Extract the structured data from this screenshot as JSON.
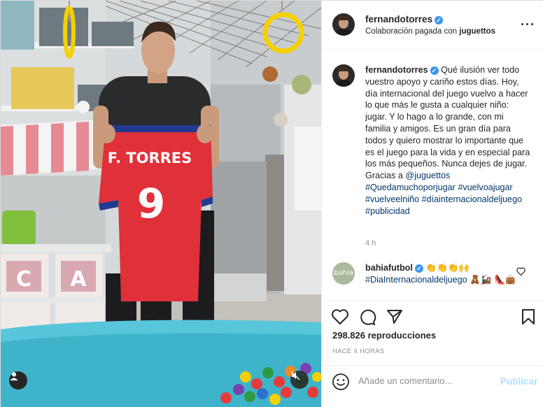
{
  "post": {
    "username": "fernandotorres",
    "verified_mark": "✓",
    "paid_prefix": "Colaboración pagada con",
    "paid_partner": "juguettos",
    "more_icon": "more-dots-icon"
  },
  "media": {
    "jersey_name": "F. TORRES",
    "jersey_number": "9",
    "box_letters": [
      "C",
      "A"
    ],
    "colors": {
      "jersey": "#e0303a",
      "ring": "#f5d000",
      "pool": "#3fb3c9"
    }
  },
  "caption": {
    "username": "fernandotorres",
    "text_main": "Qué ilusión ver todo vuestro apoyo y cariño estos días. Hoy, día internacional del juego vuelvo a hacer lo que más le gusta a cualquier niño: jugar. Y lo hago a lo grande, con mi familia y amigos. Es un gran día para todos y quiero mostrar lo importante que es el juego para la vida y en especial para los más pequeños. Nunca dejes de jugar. Gracias a",
    "mention": "@juguettos",
    "hashtags": [
      "#Quedamuchoporjugar",
      "#vuelvoajugar",
      "#vuelveelniño",
      "#díainternacionaldeljuego",
      "#publicidad"
    ],
    "time": "4 h"
  },
  "comment": {
    "username": "bahiafutbol",
    "avatar_text": "bahia",
    "emojis_1": "👏👏👏🙌",
    "hashtag": "#DiaInternacionaldeljuego",
    "emojis_2": "🧸🚂",
    "emojis_3": "👠👜"
  },
  "stats": {
    "views": "298.826 reproducciones",
    "ago": "HACE 4 HORAS"
  },
  "add_comment": {
    "placeholder": "Añade un comentario...",
    "publish": "Publicar"
  }
}
